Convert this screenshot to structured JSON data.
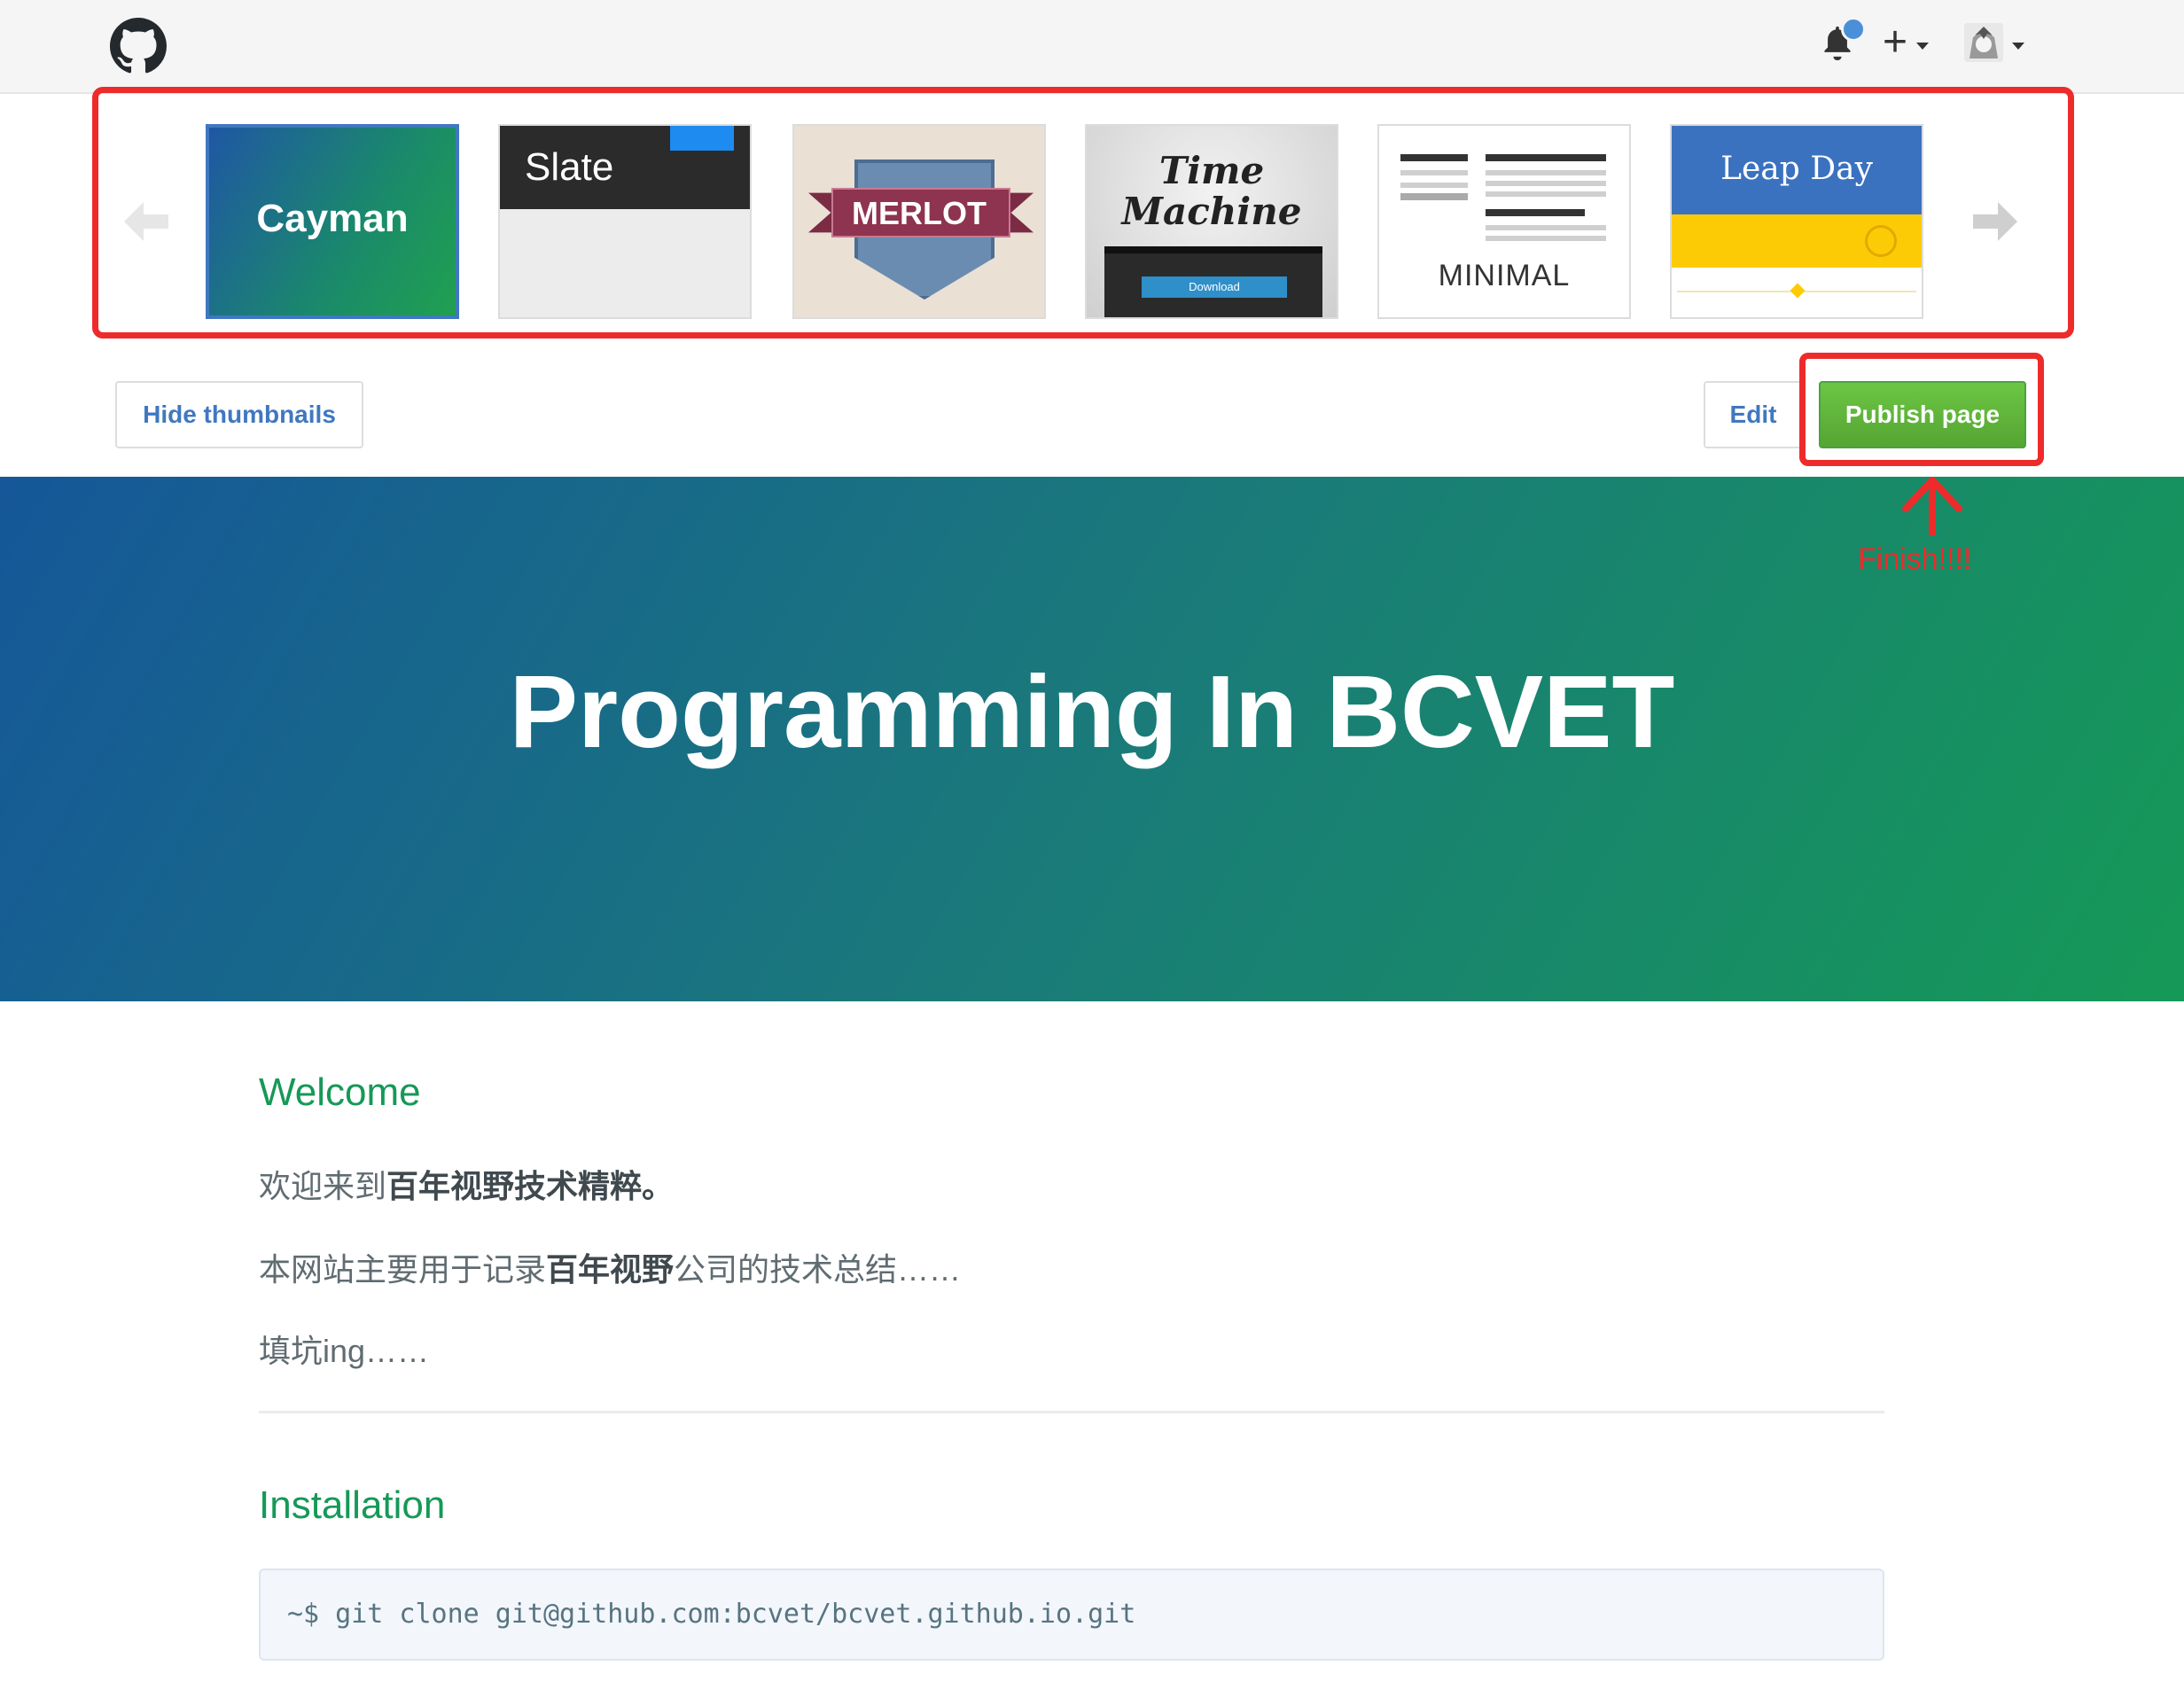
{
  "header": {
    "logo_icon": "github-octocat-icon",
    "notifications_icon": "bell-icon",
    "new_menu_label": "+",
    "avatar_icon": "user-avatar"
  },
  "themes": [
    {
      "id": "cayman",
      "label": "Cayman",
      "selected": true
    },
    {
      "id": "slate",
      "label": "Slate"
    },
    {
      "id": "merlot",
      "label": "MERLOT"
    },
    {
      "id": "time-machine",
      "label": "Time Machine",
      "line1": "Time",
      "line2": "Machine",
      "button": "Download"
    },
    {
      "id": "minimal",
      "label": "MINIMAL"
    },
    {
      "id": "leap-day",
      "label": "Leap Day"
    }
  ],
  "actions": {
    "hide_thumbnails": "Hide thumbnails",
    "edit": "Edit",
    "publish": "Publish page"
  },
  "annotation": {
    "text": "Finish!!!!",
    "color": "#ee2b2b"
  },
  "hero": {
    "title": "Programming In BCVET",
    "gradient_start": "#155799",
    "gradient_end": "#159957"
  },
  "content": {
    "welcome_heading": "Welcome",
    "p1_a": "欢迎来到",
    "p1_b": "百年视野技术精粹。",
    "p2_a": "本网站主要用于记录",
    "p2_b": "百年视野",
    "p2_c": "公司的技术总结……",
    "p3": "填坑ing……",
    "install_heading": "Installation",
    "code": "~$ git clone git@github.com:bcvet/bcvet.github.io.git"
  },
  "colors": {
    "accent": "#4078c0",
    "heading": "#159957",
    "publish": "#6cc644",
    "highlight": "#ee2b2b"
  }
}
